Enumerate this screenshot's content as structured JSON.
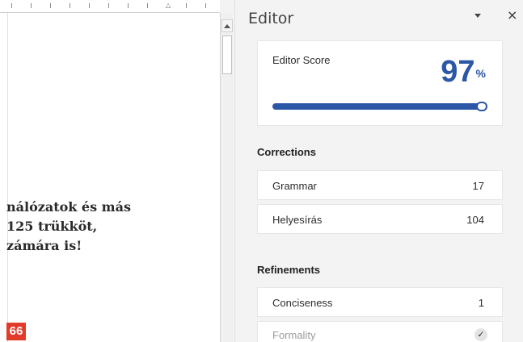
{
  "document": {
    "lines": [
      "nálózatok és más",
      " 125 trükköt,",
      "zámára is!"
    ],
    "page_number": "66"
  },
  "editor": {
    "title": "Editor",
    "dropdown_icon": "chevron-down-icon",
    "close_icon": "close-icon",
    "close_glyph": "×",
    "score": {
      "label": "Editor Score",
      "value": "97",
      "unit": "%",
      "percent": 97
    },
    "corrections": {
      "title": "Corrections",
      "items": [
        {
          "label": "Grammar",
          "count": "17"
        },
        {
          "label": "Helyesírás",
          "count": "104"
        }
      ]
    },
    "refinements": {
      "title": "Refinements",
      "items": [
        {
          "label": "Conciseness",
          "count": "1"
        },
        {
          "label": "Formality",
          "status": "✓"
        }
      ]
    }
  },
  "colors": {
    "accent": "#2b57a7",
    "page_badge": "#e23b2a"
  }
}
